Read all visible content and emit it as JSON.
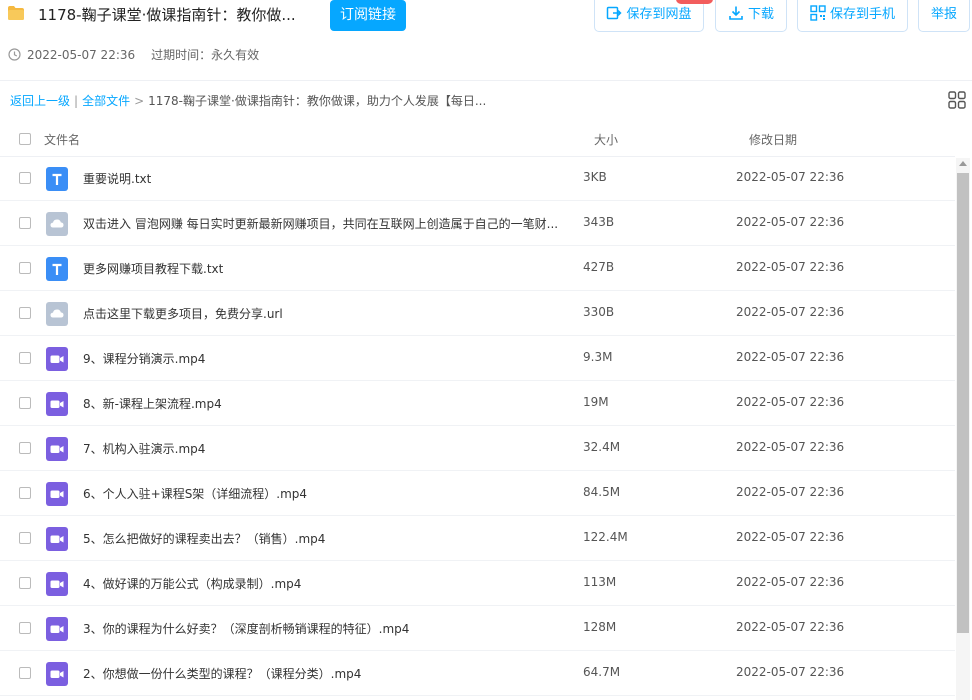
{
  "header": {
    "title": "1178-鞠子课堂·做课指南针：教你做...",
    "subscribe_label": "订阅链接",
    "save_to_netdisk_label": "保存到网盘",
    "download_label": "下载",
    "save_to_phone_label": "保存到手机",
    "report_label": "举报",
    "share_time": "2022-05-07 22:36",
    "expire_text": "过期时间：永久有效",
    "accent_color": "#06a7ff"
  },
  "breadcrumb": {
    "back_label": "返回上一级",
    "separator": "|",
    "all_files_label": "全部文件",
    "arrow": ">",
    "current": "1178-鞠子课堂·做课指南针：教你做课，助力个人发展【每日..."
  },
  "columns": {
    "name": "文件名",
    "size": "大小",
    "date": "修改日期"
  },
  "files": [
    {
      "icon": "txt-file-icon",
      "name": "重要说明.txt",
      "size": "3KB",
      "date": "2022-05-07 22:36"
    },
    {
      "icon": "link-file-icon",
      "name": "双击进入 冒泡网赚 每日实时更新最新网赚项目，共同在互联网上创造属于自己的一笔财...",
      "size": "343B",
      "date": "2022-05-07 22:36"
    },
    {
      "icon": "txt-file-icon",
      "name": "更多网赚项目教程下载.txt",
      "size": "427B",
      "date": "2022-05-07 22:36"
    },
    {
      "icon": "link-file-icon",
      "name": "点击这里下载更多项目，免费分享.url",
      "size": "330B",
      "date": "2022-05-07 22:36"
    },
    {
      "icon": "video-file-icon",
      "name": "9、课程分销演示.mp4",
      "size": "9.3M",
      "date": "2022-05-07 22:36"
    },
    {
      "icon": "video-file-icon",
      "name": "8、新-课程上架流程.mp4",
      "size": "19M",
      "date": "2022-05-07 22:36"
    },
    {
      "icon": "video-file-icon",
      "name": "7、机构入驻演示.mp4",
      "size": "32.4M",
      "date": "2022-05-07 22:36"
    },
    {
      "icon": "video-file-icon",
      "name": "6、个人入驻+课程S架（详细流程）.mp4",
      "size": "84.5M",
      "date": "2022-05-07 22:36"
    },
    {
      "icon": "video-file-icon",
      "name": "5、怎么把做好的课程卖出去？（销售）.mp4",
      "size": "122.4M",
      "date": "2022-05-07 22:36"
    },
    {
      "icon": "video-file-icon",
      "name": "4、做好课的万能公式（构成录制）.mp4",
      "size": "113M",
      "date": "2022-05-07 22:36"
    },
    {
      "icon": "video-file-icon",
      "name": "3、你的课程为什么好卖？（深度剖析畅销课程的特征）.mp4",
      "size": "128M",
      "date": "2022-05-07 22:36"
    },
    {
      "icon": "video-file-icon",
      "name": "2、你想做一份什么类型的课程？（课程分类）.mp4",
      "size": "64.7M",
      "date": "2022-05-07 22:36"
    }
  ],
  "icon_colors": {
    "txt": "#3a8ef6",
    "link": "#b8c4d4",
    "video": "#7b5fe0",
    "folder": "#f5b940"
  }
}
